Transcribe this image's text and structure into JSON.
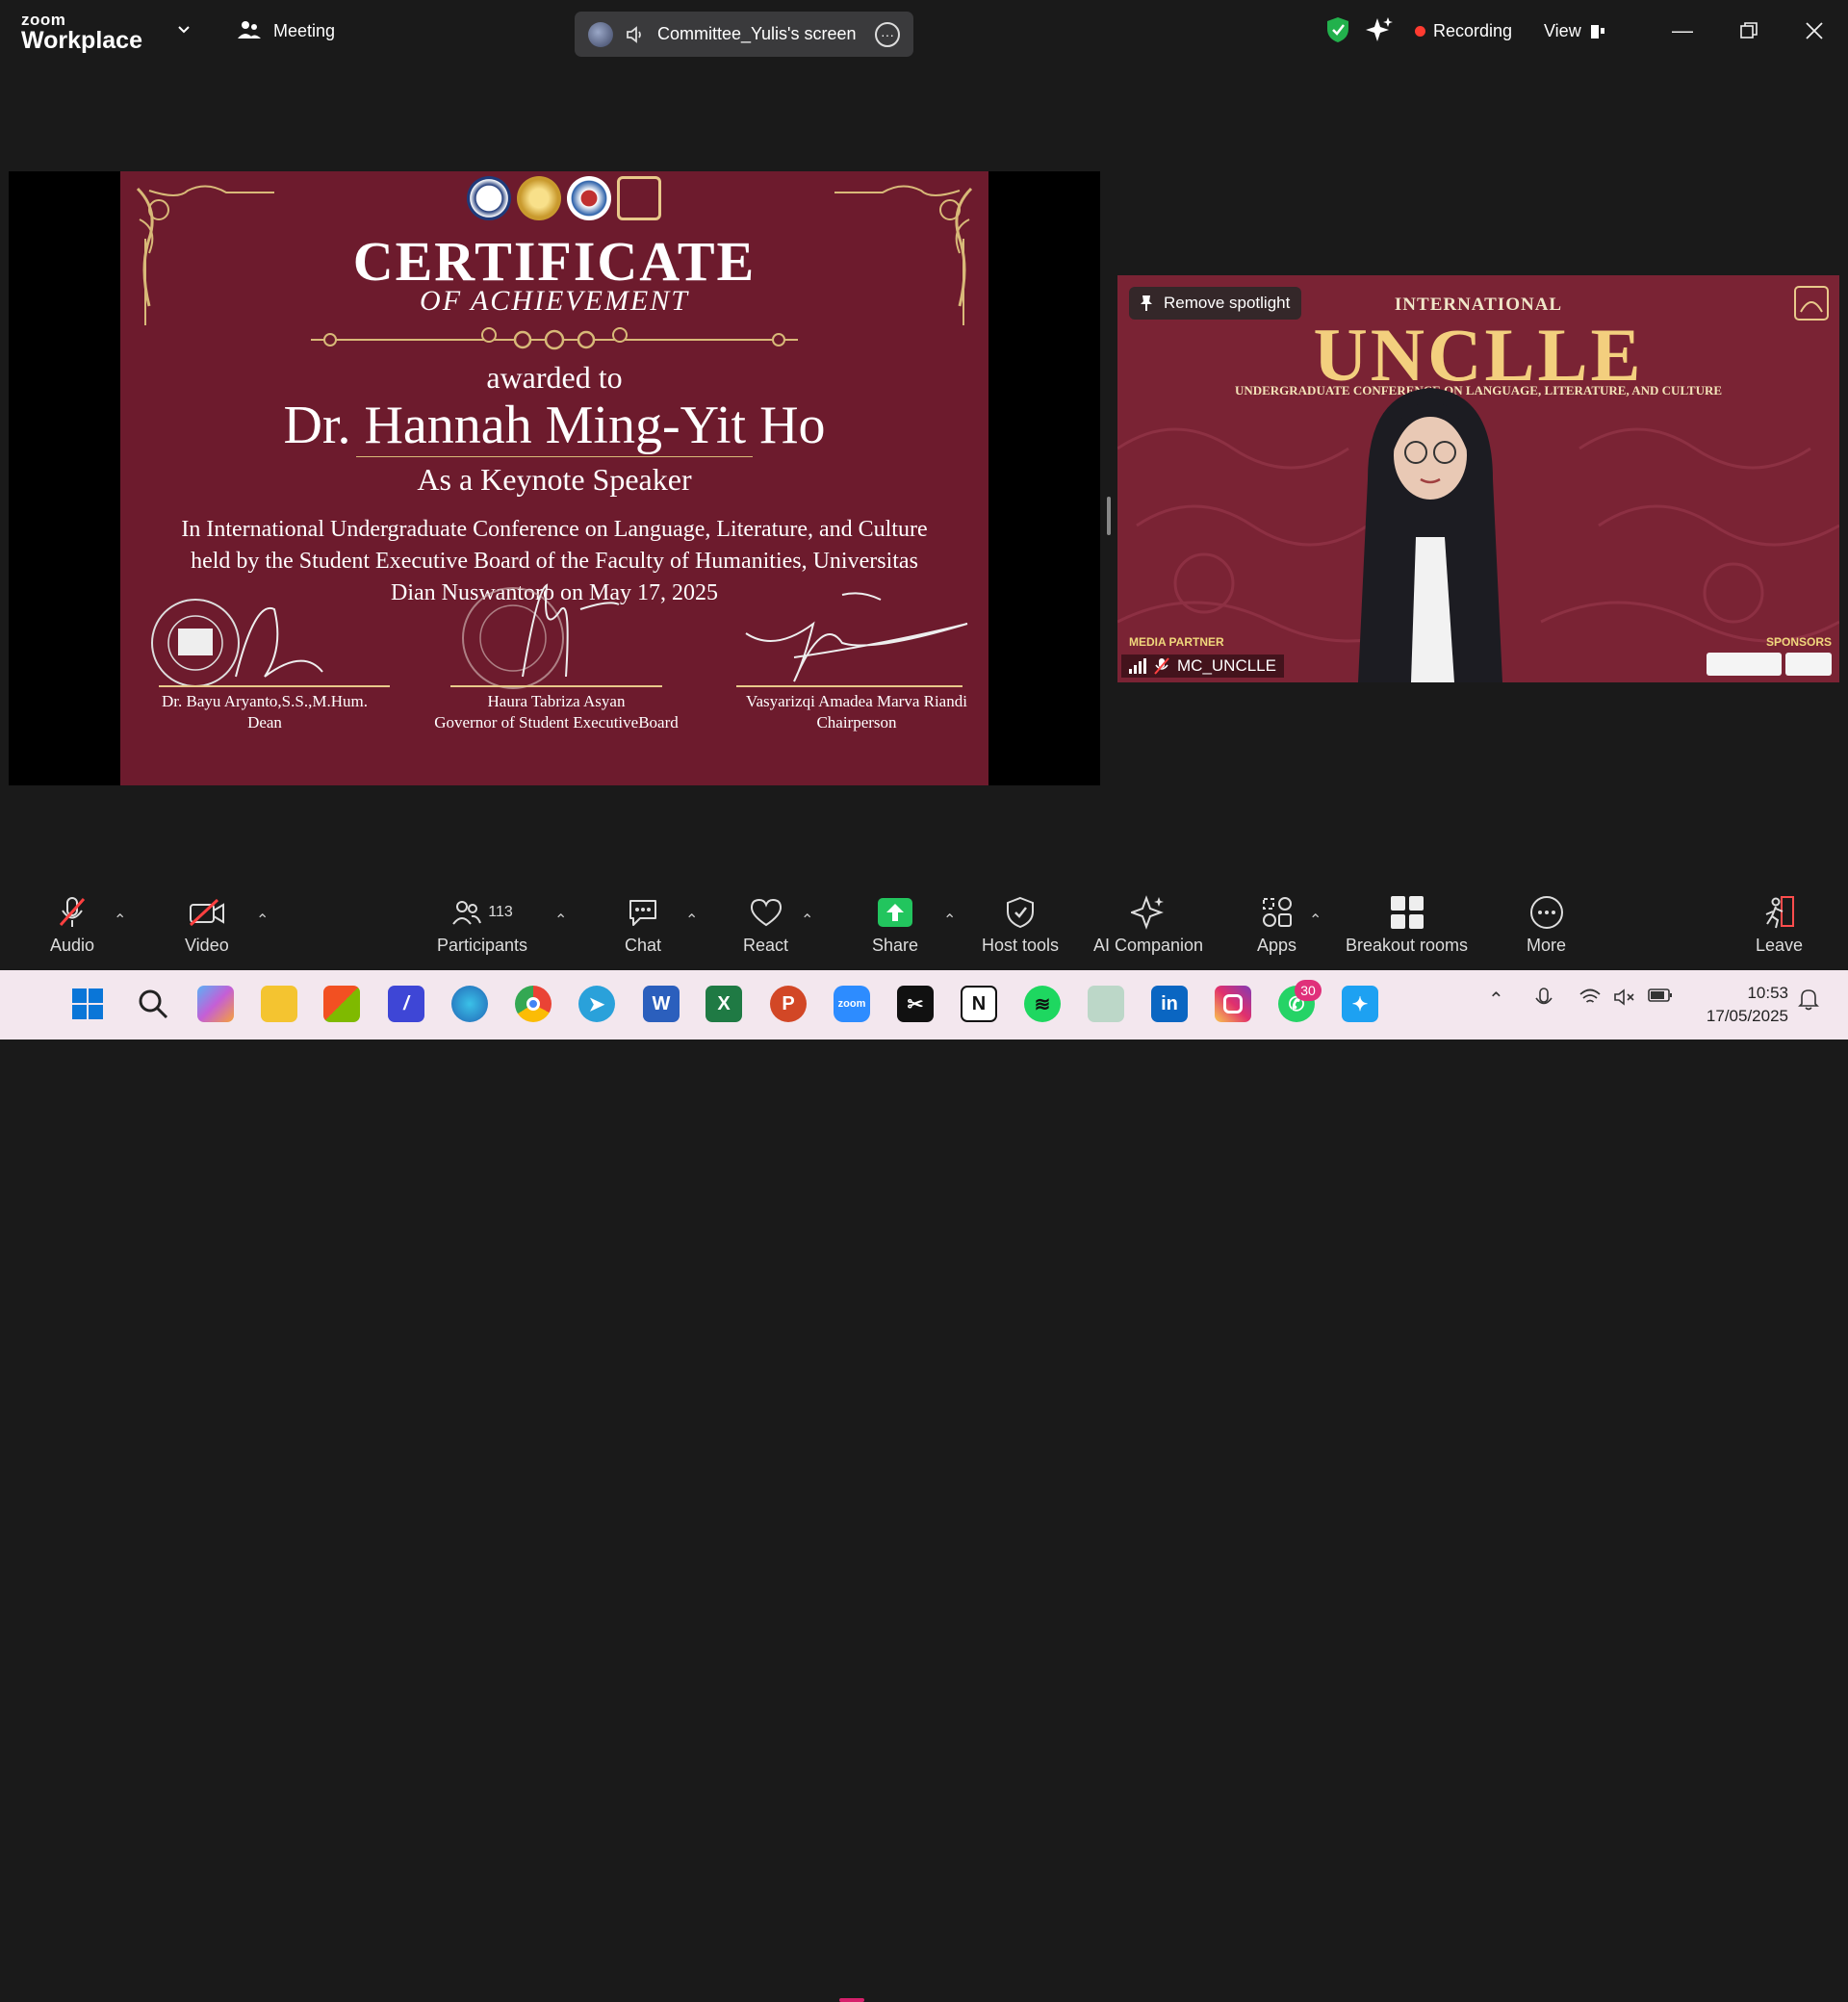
{
  "app": {
    "logo_top": "zoom",
    "logo_bottom": "Workplace",
    "meeting_label": "Meeting",
    "sharing_label": "Committee_Yulis's screen",
    "recording_label": "Recording",
    "view_label": "View"
  },
  "certificate": {
    "title": "CERTIFICATE",
    "subtitle": "OF ACHIEVEMENT",
    "awarded_to": "awarded to",
    "recipient": "Dr. Hannah Ming-Yit Ho",
    "role": "As a Keynote Speaker",
    "description": "In International Undergraduate Conference on Language, Literature, and Culture held by the Student Executive Board of the Faculty of Humanities, Universitas Dian Nuswantoro on May 17, 2025",
    "signatories": [
      {
        "name": "Dr. Bayu Aryanto,S.S.,M.Hum.",
        "title": "Dean"
      },
      {
        "name": "Haura Tabriza Asyan",
        "title": "Governor of Student ExecutiveBoard"
      },
      {
        "name": "Vasyarizqi Amadea Marva Riandi",
        "title": "Chairperson"
      }
    ],
    "colors": {
      "background": "#6d1b2d",
      "gold": "#d8b978"
    }
  },
  "video_tile": {
    "spotlight_label": "Remove spotlight",
    "banner_top": "INTERNATIONAL",
    "banner_main": "UNCLLE",
    "banner_sub": "UNDERGRADUATE CONFERENCE ON LANGUAGE, LITERATURE, AND CULTURE",
    "media_partner": "MEDIA PARTNER",
    "sponsors": "SPONSORS",
    "participant_name": "MC_UNCLLE"
  },
  "toolbar": {
    "audio": "Audio",
    "video": "Video",
    "participants": "Participants",
    "participant_count": "113",
    "chat": "Chat",
    "react": "React",
    "share": "Share",
    "host_tools": "Host tools",
    "ai_companion": "AI Companion",
    "apps": "Apps",
    "breakout": "Breakout rooms",
    "more": "More",
    "leave": "Leave"
  },
  "taskbar": {
    "whatsapp_badge": "30",
    "time": "10:53",
    "date": "17/05/2025"
  }
}
